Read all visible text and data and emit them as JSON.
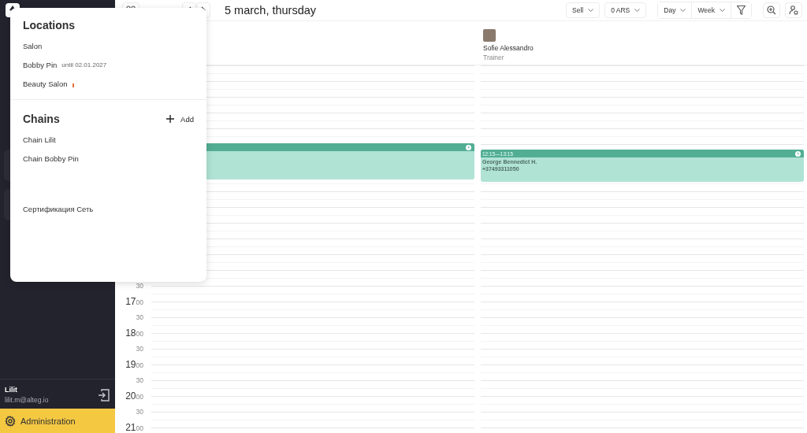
{
  "sidebar": {
    "user": {
      "name": "Lilit",
      "email": "lilit.m@alteg.io"
    },
    "admin_button": "Administration"
  },
  "toolbar": {
    "title": "5 march, thursday",
    "sell": "Sell",
    "balance": "0 ARS",
    "view_modes": [
      {
        "label": "Day",
        "selected": false
      },
      {
        "label": "Week",
        "selected": false
      }
    ]
  },
  "columns": [
    {
      "events": [
        {
          "kind": "appointment"
        }
      ]
    },
    {
      "staff": {
        "name": "Sofie Alessandro",
        "role": "Trainer"
      },
      "events": [
        {
          "kind": "appointment",
          "time": "12:15—13:15",
          "client": "George Bennedict H.",
          "phone": "+37493311050"
        }
      ]
    }
  ],
  "time_labels": [
    {
      "kind": "half",
      "minutes": "30"
    },
    {
      "kind": "hour",
      "hour": "17",
      "minutes": "00"
    },
    {
      "kind": "half",
      "minutes": "30"
    },
    {
      "kind": "hour",
      "hour": "18",
      "minutes": "00"
    },
    {
      "kind": "half",
      "minutes": "30"
    },
    {
      "kind": "hour",
      "hour": "19",
      "minutes": "00"
    },
    {
      "kind": "half",
      "minutes": "30"
    },
    {
      "kind": "hour",
      "hour": "20",
      "minutes": "00"
    },
    {
      "kind": "half",
      "minutes": "30"
    },
    {
      "kind": "hour",
      "hour": "21",
      "minutes": "00"
    }
  ],
  "popover": {
    "locations_title": "Locations",
    "locations": [
      {
        "name": "Salon",
        "flag": false
      },
      {
        "name": "Bobby Pin",
        "note": "until 02.01.2027",
        "flag": false
      },
      {
        "name": "Beauty Salon",
        "flag": true
      }
    ],
    "chains_title": "Chains",
    "add_button": "Add",
    "chains": [
      {
        "name": "Chain Lilit"
      },
      {
        "name": "Chain Bobby Pin"
      },
      {
        "name": "Сертификация Сеть"
      }
    ]
  }
}
